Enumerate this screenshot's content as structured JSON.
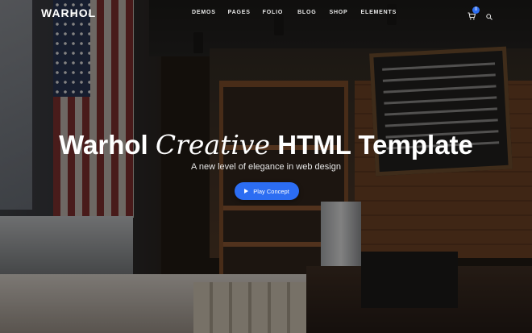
{
  "brand": {
    "logo_text": "WARHOL"
  },
  "nav": {
    "items": [
      {
        "label": "DEMOS"
      },
      {
        "label": "PAGES"
      },
      {
        "label": "FOLIO"
      },
      {
        "label": "BLOG"
      },
      {
        "label": "SHOP"
      },
      {
        "label": "ELEMENTS"
      }
    ],
    "cart_count": "0",
    "icons": {
      "cart": "cart-icon",
      "search": "search-icon"
    }
  },
  "hero": {
    "title_part1": "Warhol",
    "title_accent": "Creative",
    "title_part2": "HTML Template",
    "subtitle": "A new level of elegance in web design",
    "cta_label": "Play Concept",
    "cta_icon": "play-icon"
  },
  "colors": {
    "accent": "#2c6df2",
    "text": "#ffffff"
  }
}
